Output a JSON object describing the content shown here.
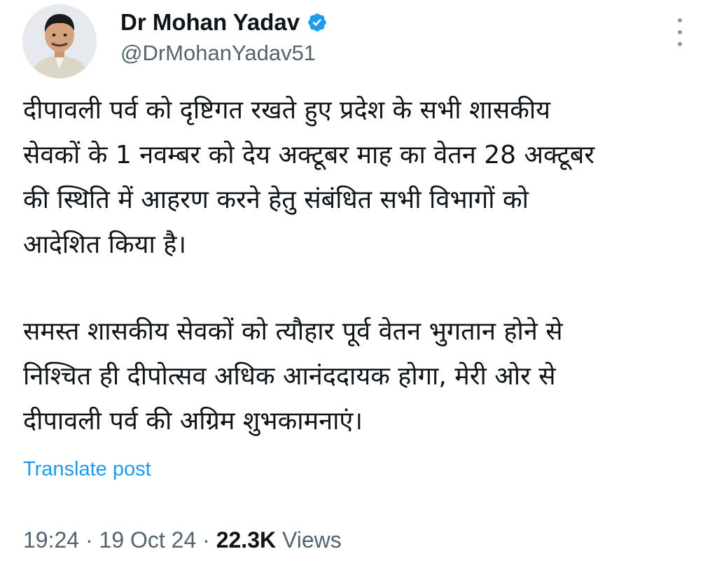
{
  "author": {
    "display_name": "Dr Mohan Yadav",
    "handle": "@DrMohanYadav51",
    "verified": true
  },
  "tweet": {
    "paragraph1": [
      "दीपावली पर्व को दृष्टिगत रखते हुए प्रदेश के सभी शासकीय",
      "सेवकों के 1 नवम्बर को देय अक्टूबर माह का वेतन 28 अक्टूबर",
      "की स्थिति में आहरण करने हेतु संबंधित सभी विभागों को",
      "आदेशित किया है।"
    ],
    "paragraph2": [
      "समस्त शासकीय सेवकों को त्यौहार पूर्व वेतन भुगतान होने से",
      "निश्चित ही दीपोत्सव अधिक आनंददायक होगा, मेरी ओर से",
      "दीपावली पर्व की अग्रिम शुभकामनाएं।"
    ]
  },
  "translate_label": "Translate post",
  "meta": {
    "time": "19:24",
    "separator": "·",
    "date": "19 Oct 24",
    "views_count": "22.3K",
    "views_label": "Views"
  },
  "icons": {
    "verified": "verified-badge-icon",
    "more": "more-options-icon"
  },
  "colors": {
    "accent": "#1d9bf0",
    "text_primary": "#0f1419",
    "text_secondary": "#536471"
  }
}
